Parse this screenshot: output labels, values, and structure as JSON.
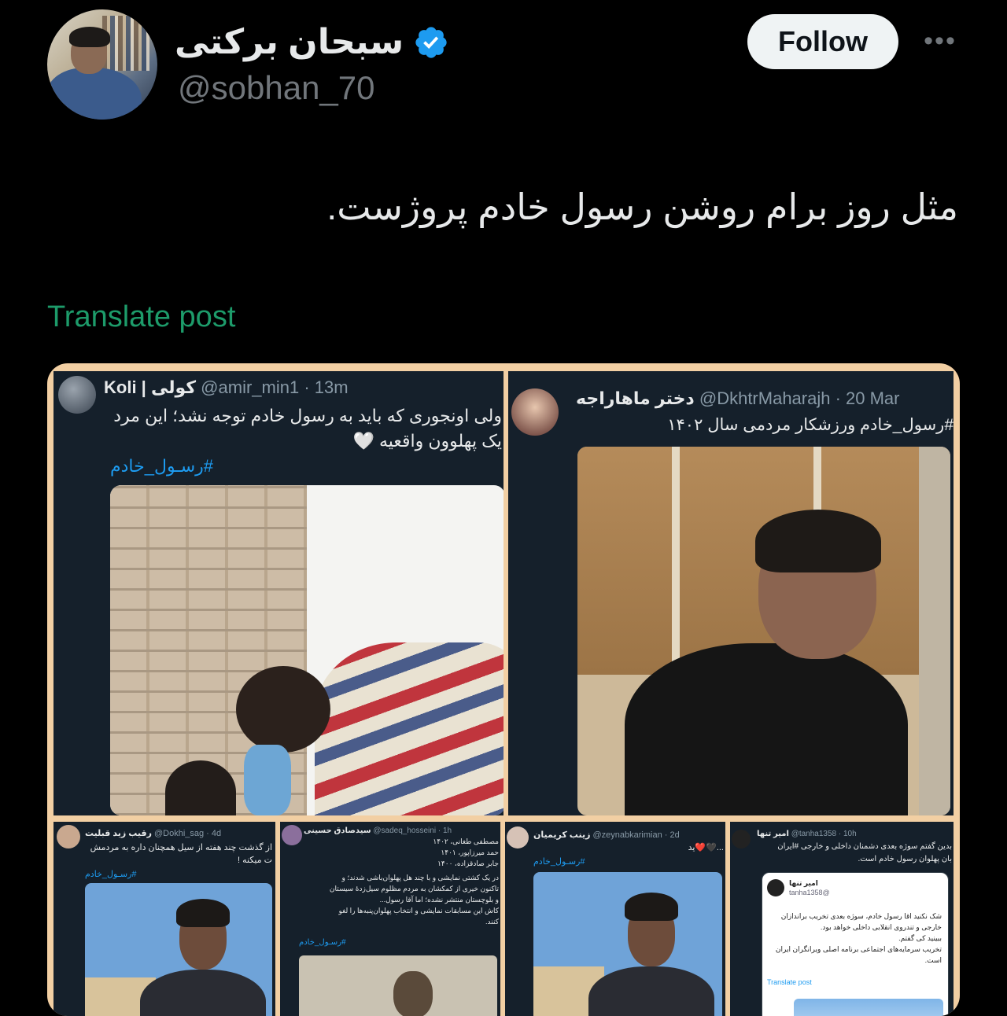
{
  "author": {
    "display_name": "سبحان برکتی",
    "handle": "@sobhan_70",
    "verified": true
  },
  "actions": {
    "follow_label": "Follow",
    "more_label": "•••"
  },
  "post": {
    "text": "مثل روز برام روشن رسول خادم پروژست.",
    "translate_label": "Translate post"
  },
  "colors": {
    "background": "#000000",
    "verified_blue": "#1d9bf0",
    "translate_green": "#1d9b6a",
    "collage_border": "#f2cfa3"
  },
  "media": {
    "panel1": {
      "name": "Koli | کولی",
      "handle_time": "@amir_min1 · 13m",
      "line1": "ولی اونجوری که باید به رسول خادم توجه نشد؛ این مرد",
      "line2": "یک پهلوون واقعیه 🤍",
      "hashtag": "#رسـول_خادم"
    },
    "panel2": {
      "name": "دختر ماهاراجه",
      "handle_time": "@DkhtrMaharajh · 20 Mar",
      "line1": "#رسول_خادم ورزشکار مردمی سال ۱۴۰۲"
    },
    "panel3": {
      "name": "رقیب زید قبلیت",
      "handle_time": "@Dokhi_sag · 4d",
      "line1": "از گذشت چند هفته از سیل همچنان داره به مردمش",
      "line2": "ت میکنه !",
      "hashtag": "#رسـول_خادم"
    },
    "panel4": {
      "name": "سیدصادق حسینی",
      "handle_time": "@sadeq_hosseini · 1h",
      "lines": [
        "مصطفی طغانی، ۱۴۰۲",
        "حمد میرزاپور، ۱۴۰۱",
        "جابر صادقزاده، ۱۴۰۰",
        "در یک کشتی نمایشی و با چند هل پهلوان‌باشی شدند؛ و",
        "تاکنون خیری از کمکشان به مردم مظلوم سیل‌زدهٔ سیستان",
        "و بلوچستان منتشر نشده؛ اما آقا رسول...",
        "کاش این مسابقات نمایشی و انتخاب پهلوان‌پنبه‌ها را لغو",
        "کنند."
      ],
      "hashtag": "#رسـول_خادم"
    },
    "panel5": {
      "name": "زینب کریمیان",
      "handle_time": "@zeynabkarimian · 2d",
      "line1": "...🖤❤️ید",
      "hashtag": "#رسـول_خادم"
    },
    "panel6": {
      "name": "امیر تنها",
      "handle_time": "@tanha1358 · 10h",
      "line1": "بدین گفتم سوژه بعدی دشمنان داخلی و خارجی #ایران",
      "line2": "بان پهلوان رسول خادم است.",
      "embed_name": "امیر تنها",
      "embed_handle": "@tanha1358",
      "embed_lines": [
        "شک نکنید اقا رسول خادم، سوژه بعدی تخریب براندازان",
        "خارجی و تندروی انقلابی داخلی خواهد بود.",
        "ببینید کی گفتم.",
        "تخریب سرمایه‌های اجتماعی برنامه اصلی ویرانگران ایران",
        "است."
      ],
      "embed_translate": "Translate post"
    }
  }
}
